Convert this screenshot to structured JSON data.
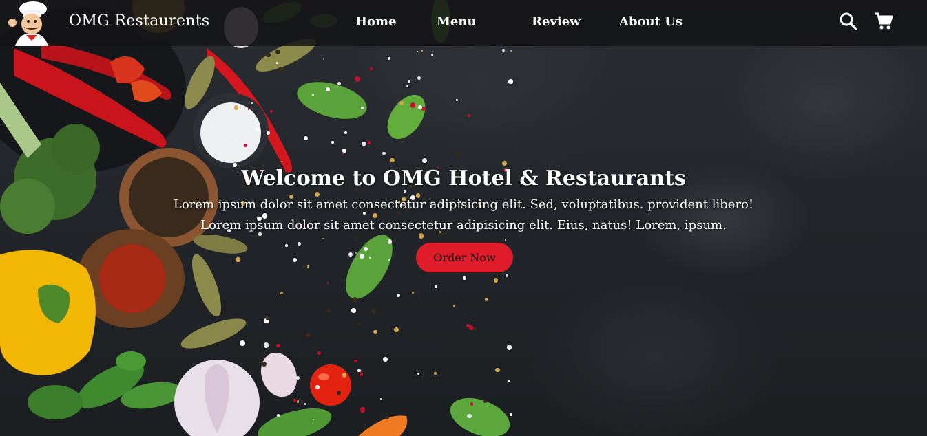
{
  "header": {
    "brand": "OMG Restaurents",
    "nav": [
      {
        "label": "Home"
      },
      {
        "label": "Menu"
      },
      {
        "label": "Review"
      },
      {
        "label": "About Us"
      }
    ],
    "icons": [
      "search-icon",
      "cart-icon"
    ]
  },
  "hero": {
    "title": "Welcome to OMG Hotel & Restaurants",
    "line1": "Lorem ipsum dolor sit amet consectetur adipisicing elit. Sed, voluptatibus. provident libero!",
    "line2": "Lorem ipsum dolor sit amet consectetur adipisicing elit. Eius, natus! Lorem, ipsum.",
    "button_label": "Order Now"
  },
  "colors": {
    "accent": "#e01b2a",
    "header_bg": "#141416",
    "background": "#222529"
  }
}
